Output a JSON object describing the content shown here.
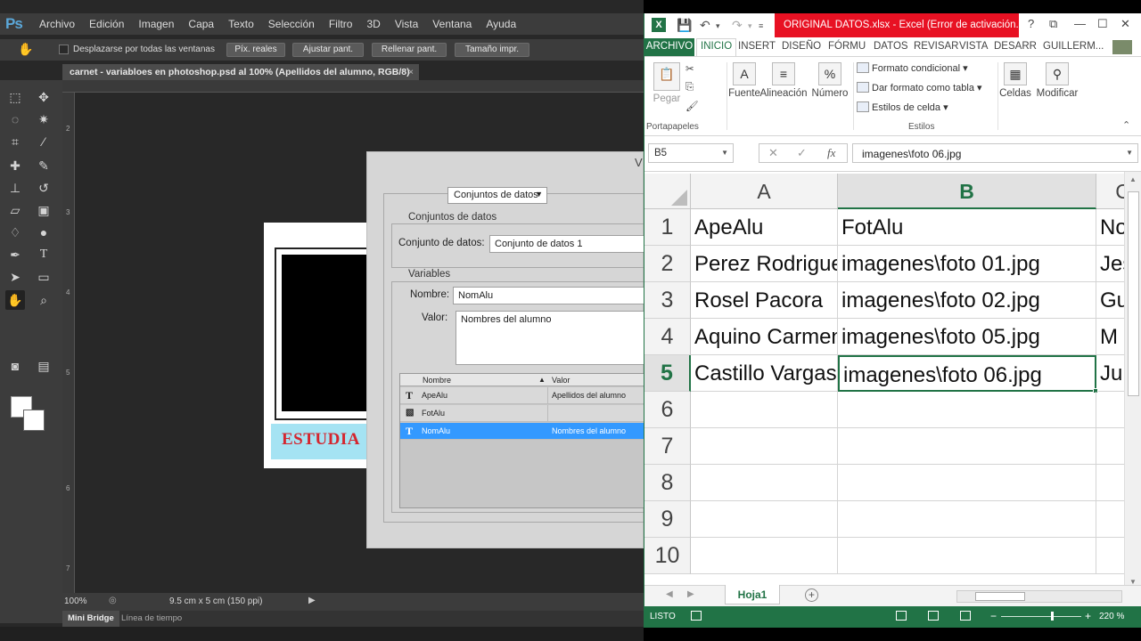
{
  "photoshop": {
    "logo": "Ps",
    "menu": [
      "Archivo",
      "Edición",
      "Imagen",
      "Capa",
      "Texto",
      "Selección",
      "Filtro",
      "3D",
      "Vista",
      "Ventana",
      "Ayuda"
    ],
    "options": {
      "scroll_all_label": "Desplazarse por todas las ventanas",
      "buttons": [
        "Píx. reales",
        "Ajustar pant.",
        "Rellenar pant.",
        "Tamaño impr."
      ]
    },
    "doc_tab": "carnet - variabloes en photoshop.psd al 100% (Apellidos del alumno, RGB/8)",
    "doc_tab_close": "×",
    "ruler_marks": [
      "2",
      "3",
      "4",
      "5",
      "6",
      "7"
    ],
    "canvas": {
      "band_text": "ESTUDIA",
      "band_color": "#a5e3f3",
      "text_color": "#d4262f"
    },
    "status": {
      "zoom": "100%",
      "doc_info": "9.5 cm x 5 cm (150 ppi)"
    },
    "bottom_tabs": [
      "Mini Bridge",
      "Línea de tiempo"
    ],
    "dialog": {
      "title": "V",
      "mode_select": "Conjuntos de datos",
      "datasets_group": "Conjuntos de datos",
      "datasets_label": "Conjunto de datos:",
      "datasets_value": "Conjunto de datos 1",
      "variables_group": "Variables",
      "name_label": "Nombre:",
      "name_value": "NomAlu",
      "value_label": "Valor:",
      "value_value": "Nombres del alumno",
      "table_headers": [
        "Nombre",
        "Valor"
      ],
      "sort_icon": "▲",
      "rows": [
        {
          "icon": "T",
          "name": "ApeAlu",
          "value": "Apellidos del alumno"
        },
        {
          "icon": "image",
          "name": "FotAlu",
          "value": ""
        },
        {
          "icon": "T",
          "name": "NomAlu",
          "value": "Nombres del alumno"
        }
      ]
    }
  },
  "excel": {
    "logo": "X",
    "title": "ORIGINAL DATOS.xlsx - Excel (Error de activación...",
    "window_controls": [
      "?",
      "⧉",
      "—",
      "☐",
      "✕"
    ],
    "tabs": [
      "ARCHIVO",
      "INICIO",
      "INSERT",
      "DISEÑO",
      "FÓRMU",
      "DATOS",
      "REVISAR",
      "VISTA",
      "DESARR",
      "GUILLERM..."
    ],
    "ribbon": {
      "paste": "Pegar",
      "font": "Fuente",
      "alignment": "Alineación",
      "number": "Número",
      "conditional": "Formato condicional",
      "as_table": "Dar formato como tabla",
      "cell_styles": "Estilos de celda",
      "cells": "Celdas",
      "modify": "Modificar",
      "group_clipboard": "Portapapeles",
      "group_styles": "Estilos"
    },
    "name_box": "B5",
    "formula": "imagenes\\foto 06.jpg",
    "columns": [
      "A",
      "B",
      "C"
    ],
    "rows": [
      [
        "ApeAlu",
        "FotAlu",
        "No"
      ],
      [
        "Perez Rodriguez",
        "imagenes\\foto 01.jpg",
        "Jes"
      ],
      [
        "Rosel Pacora",
        "imagenes\\foto 02.jpg",
        "Gu"
      ],
      [
        "Aquino Carmen",
        "imagenes\\foto 05.jpg",
        "M"
      ],
      [
        "Castillo Vargas",
        "imagenes\\foto 06.jpg",
        "Ju"
      ],
      [
        "",
        "",
        ""
      ],
      [
        "",
        "",
        ""
      ],
      [
        "",
        "",
        ""
      ],
      [
        "",
        "",
        ""
      ],
      [
        "",
        "",
        ""
      ]
    ],
    "row_numbers": [
      "1",
      "2",
      "3",
      "4",
      "5",
      "6",
      "7",
      "8",
      "9",
      "10"
    ],
    "active_cell": "B5",
    "sheet_tab": "Hoja1",
    "status": {
      "ready": "LISTO",
      "zoom": "220 %"
    },
    "colors": {
      "accent": "#217346",
      "title_bar": "#e81123"
    }
  }
}
